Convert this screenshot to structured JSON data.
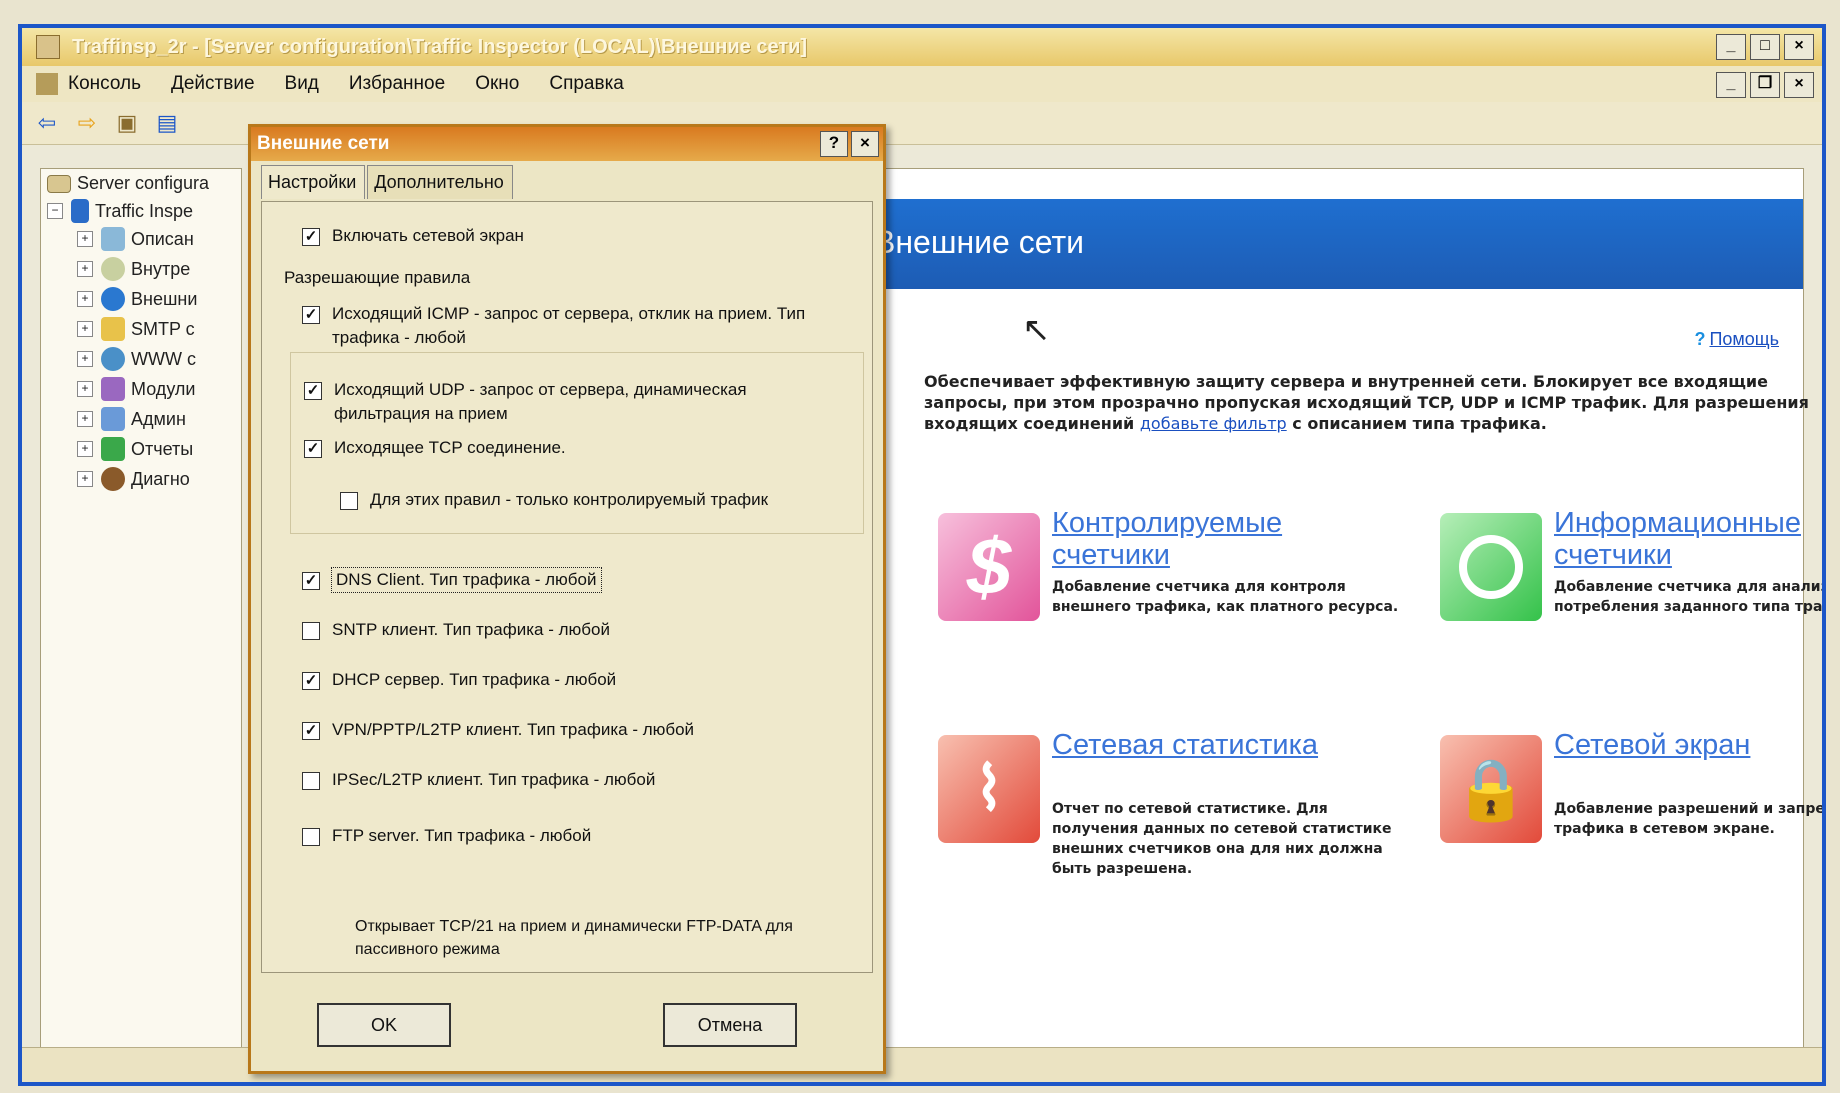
{
  "window": {
    "title": "Traffinsp_2r - [Server configuration\\Traffic Inspector (LOCAL)\\Внешние сети]",
    "controls": [
      "_",
      "□",
      "×"
    ],
    "mdi_controls": [
      "_",
      "❐",
      "×"
    ]
  },
  "menu": [
    {
      "label": "Консоль"
    },
    {
      "label": "Действие"
    },
    {
      "label": "Вид"
    },
    {
      "label": "Избранное"
    },
    {
      "label": "Окно"
    },
    {
      "label": "Справка"
    }
  ],
  "tree": {
    "root": "Server configura",
    "node": "Traffic Inspe",
    "items": [
      "Описан",
      "Внутре",
      "Внешни",
      "SMTP с",
      "WWW с",
      "Модули",
      "Админ",
      "Отчеты",
      "Диагно"
    ]
  },
  "content": {
    "banner_title": "Внешние сети",
    "help_label": "Помощь",
    "description_before_link": "Обеспечивает эффективную защиту сервера и внутренней сети. Блокирует все входящие запросы, при этом прозрачно пропуская исходящий TCP, UDP и ICMP трафик. Для разрешения входящих соединений",
    "description_link": "добавьте фильтр",
    "description_after_link": "с описанием типа трафика.",
    "cards": [
      {
        "title": "Контролируемые счетчики",
        "desc": "Добавление счетчика для контроля внешнего трафика, как платного ресурса.",
        "icon": "dollar-icon",
        "color": "#e2549a"
      },
      {
        "title": "Информационные счетчики",
        "desc": "Добавление счетчика для анализ потребления заданного типа трафика.",
        "icon": "clock-icon",
        "color": "#34c24a"
      },
      {
        "title": "Сетевая статистика",
        "desc": "Отчет по сетевой статистике. Для получения данных по сетевой статистике внешних счетчиков она для них должна быть разрешена.",
        "icon": "chart-icon",
        "color": "#e24a3a"
      },
      {
        "title": "Сетевой экран",
        "desc": "Добавление разрешений и запрещений трафика в сетевом экране.",
        "icon": "lock-icon",
        "color": "#e24a3a"
      }
    ]
  },
  "dialog": {
    "title": "Внешние сети",
    "title_buttons": [
      "?",
      "×"
    ],
    "tabs": [
      "Настройки",
      "Дополнительно"
    ],
    "enable_firewall": {
      "label": "Включать сетевой экран",
      "checked": true
    },
    "rules_group_label": "Разрешающие правила",
    "rules": [
      {
        "label": "Исходящий ICMP - запрос от сервера, отклик на прием. Тип трафика - любой",
        "checked": true
      },
      {
        "label": "Исходящий UDP - запрос от сервера, динамическая фильтрация на прием",
        "checked": true
      },
      {
        "label": "Исходящее TCP соединение.",
        "checked": true
      },
      {
        "label": "Для этих правил - только контролируемый трафик",
        "checked": false
      }
    ],
    "services": [
      {
        "label": "DNS Client. Тип трафика - любой",
        "checked": true
      },
      {
        "label": "SNTP клиент. Тип трафика - любой",
        "checked": false
      },
      {
        "label": "DHCP сервер. Тип трафика - любой",
        "checked": true
      },
      {
        "label": "VPN/PPTP/L2TP клиент. Тип трафика - любой",
        "checked": true
      },
      {
        "label": "IPSec/L2TP клиент. Тип трафика - любой",
        "checked": false
      },
      {
        "label": "FTP server. Тип трафика - любой",
        "checked": false
      }
    ],
    "ftp_note": "Открывает TCP/21 на прием и динамически FTP-DATA для пассивного режима",
    "ok_label": "OK",
    "cancel_label": "Отмена"
  }
}
